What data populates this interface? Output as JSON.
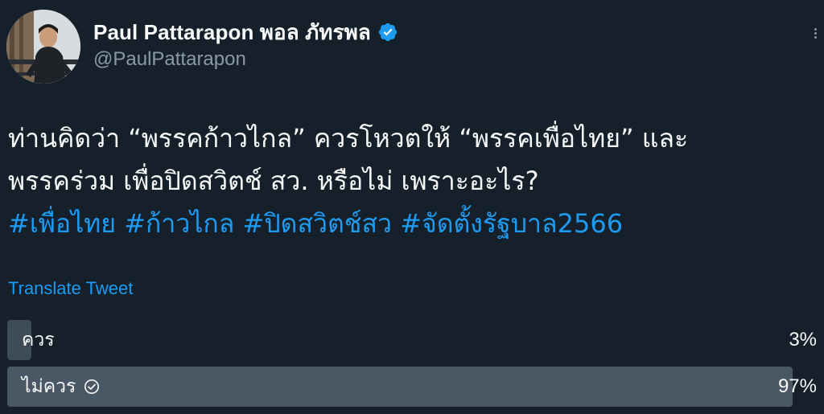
{
  "author": {
    "display_name": "Paul Pattarapon พอล ภัทรพล",
    "handle": "@PaulPattarapon",
    "verified": true,
    "avatar_icon": "profile-photo"
  },
  "tweet": {
    "lines": [
      "ท่านคิดว่า “พรรคก้าวไกล” ควรโหวตให้ “พรรคเพื่อไทย” และ",
      "พรรคร่วม เพื่อปิดสวิตช์ สว. หรือไม่ เพราะอะไร?"
    ],
    "hashtags": [
      "#เพื่อไทย",
      "#ก้าวไกล",
      "#ปิดสวิตช์สว",
      "#จัดตั้งรัฐบาล2566"
    ]
  },
  "translate_label": "Translate Tweet",
  "poll": {
    "options": [
      {
        "label": "ควร",
        "percent_text": "3%",
        "percent": 3,
        "winner": false
      },
      {
        "label": "ไม่ควร",
        "percent_text": "97%",
        "percent": 97,
        "winner": true
      }
    ]
  },
  "colors": {
    "background": "#15202b",
    "link": "#1d9bf0",
    "secondary_text": "#8b98a5",
    "poll_bar": "#3f4b57",
    "poll_bar_winner": "#4a5866",
    "verified_badge": "#1d9bf0"
  }
}
